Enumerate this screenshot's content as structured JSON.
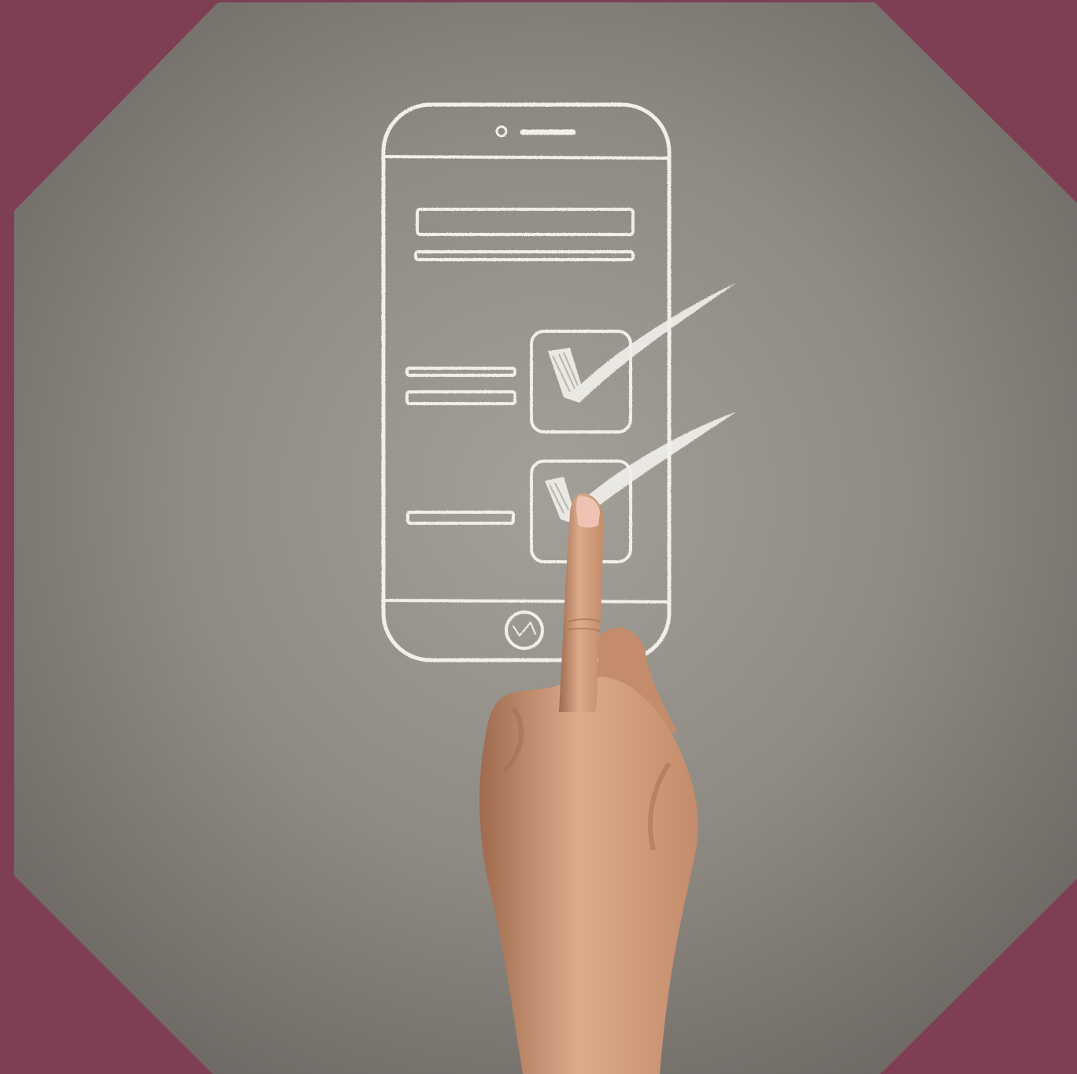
{
  "colors": {
    "frame": "#7e3f55",
    "board_center": "#a39f99",
    "board_mid": "#8f8a84",
    "board_edge": "#6f6a65",
    "chalk": "#f1efe9",
    "skin_light": "#dcab8a",
    "skin_mid": "#c48c6b",
    "skin_dark": "#9f6a4d",
    "nail": "#eec3b4"
  },
  "icons": {
    "frame": "octagon-frame",
    "phone": "smartphone-sketch-icon",
    "check": "checkmark-icon",
    "home": "home-button-icon",
    "hand": "pointing-hand"
  },
  "checklist": {
    "items": [
      {
        "checked": true
      },
      {
        "checked": true
      }
    ]
  }
}
